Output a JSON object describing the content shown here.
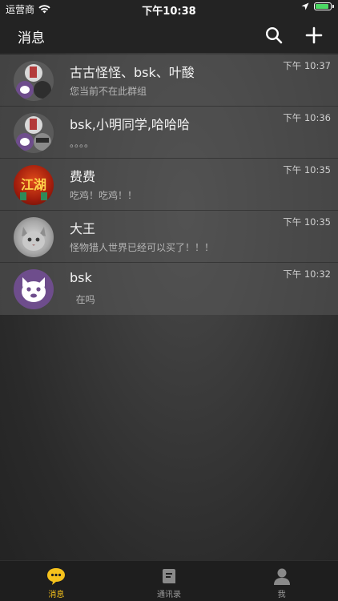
{
  "status_bar": {
    "carrier": "运营商",
    "time": "下午10:38",
    "icons": [
      "wifi-icon",
      "location-arrow-icon",
      "battery-icon"
    ],
    "battery_level": 0.9
  },
  "nav": {
    "title": "消息",
    "actions": [
      "search-icon",
      "plus-icon"
    ]
  },
  "chats": [
    {
      "name": "古古怪怪、bsk、叶酸",
      "preview": "您当前不在此群组",
      "time": "下午 10:37",
      "avatar": "group-avatar"
    },
    {
      "name": "bsk,小明同学,哈哈哈",
      "preview": "。。。。",
      "time": "下午 10:36",
      "avatar": "group-avatar"
    },
    {
      "name": "费费",
      "preview": "吃鸡！吃鸡！！",
      "time": "下午 10:35",
      "avatar": "game-poster-avatar",
      "avatar_text": "江湖"
    },
    {
      "name": "大王",
      "preview": "怪物猎人世界已经可以买了！！！",
      "time": "下午 10:35",
      "avatar": "cat-photo-avatar"
    },
    {
      "name": "bsk",
      "preview": "  在吗",
      "time": "下午 10:32",
      "avatar": "purple-cat-avatar"
    }
  ],
  "tabs": [
    {
      "label": "消息",
      "icon": "chat-bubble-icon",
      "active": true
    },
    {
      "label": "通讯录",
      "icon": "contacts-icon",
      "active": false
    },
    {
      "label": "我",
      "icon": "person-icon",
      "active": false
    }
  ],
  "colors": {
    "accent": "#f6c21c",
    "bar_bg": "#232323",
    "list_bg": "#4a4a4a",
    "avatar_purple": "#6e4d8c",
    "battery_green": "#4cd964"
  }
}
